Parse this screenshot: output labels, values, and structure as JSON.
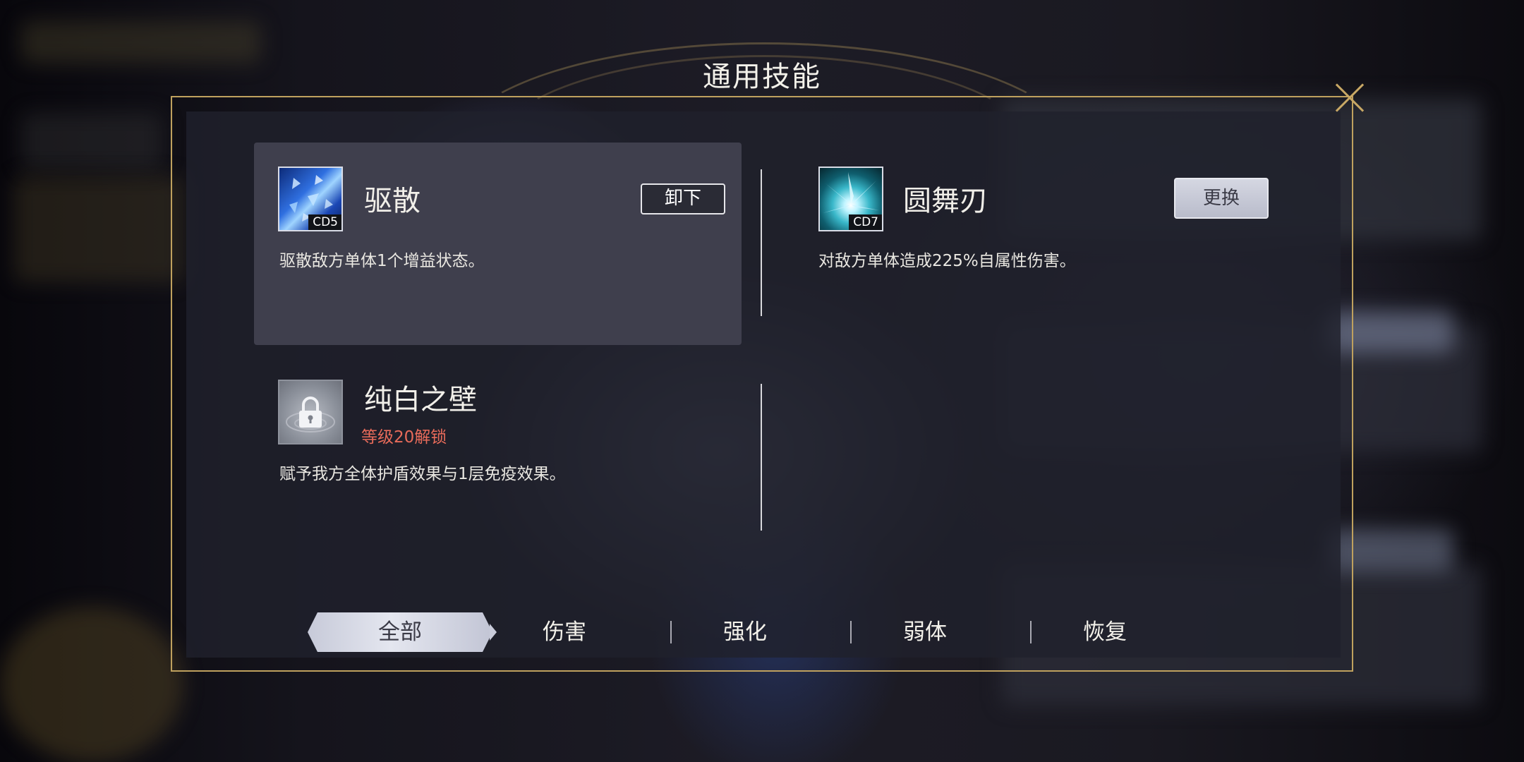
{
  "dialog": {
    "title": "通用技能"
  },
  "skills": [
    {
      "name": "驱散",
      "cd": "CD5",
      "description": "驱散敌方单体1个增益状态。",
      "action_label": "卸下",
      "selected": true,
      "icon": "shatter-icon"
    },
    {
      "name": "圆舞刃",
      "cd": "CD7",
      "description": "对敌方单体造成225%自属性伤害。",
      "action_label": "更换",
      "selected": false,
      "icon": "blade-burst-icon"
    },
    {
      "name": "纯白之壁",
      "unlock_text": "等级20解锁",
      "description": "赋予我方全体护盾效果与1层免疫效果。",
      "locked": true,
      "icon": "lock-icon"
    }
  ],
  "tabs": [
    {
      "label": "全部",
      "active": true
    },
    {
      "label": "伤害",
      "active": false
    },
    {
      "label": "强化",
      "active": false
    },
    {
      "label": "弱体",
      "active": false
    },
    {
      "label": "恢复",
      "active": false
    }
  ],
  "colors": {
    "frame_gold": "#bfa15e",
    "unlock_red": "#e86b5a",
    "panel": "#20212c",
    "selected_card": "#3f3f4d"
  }
}
